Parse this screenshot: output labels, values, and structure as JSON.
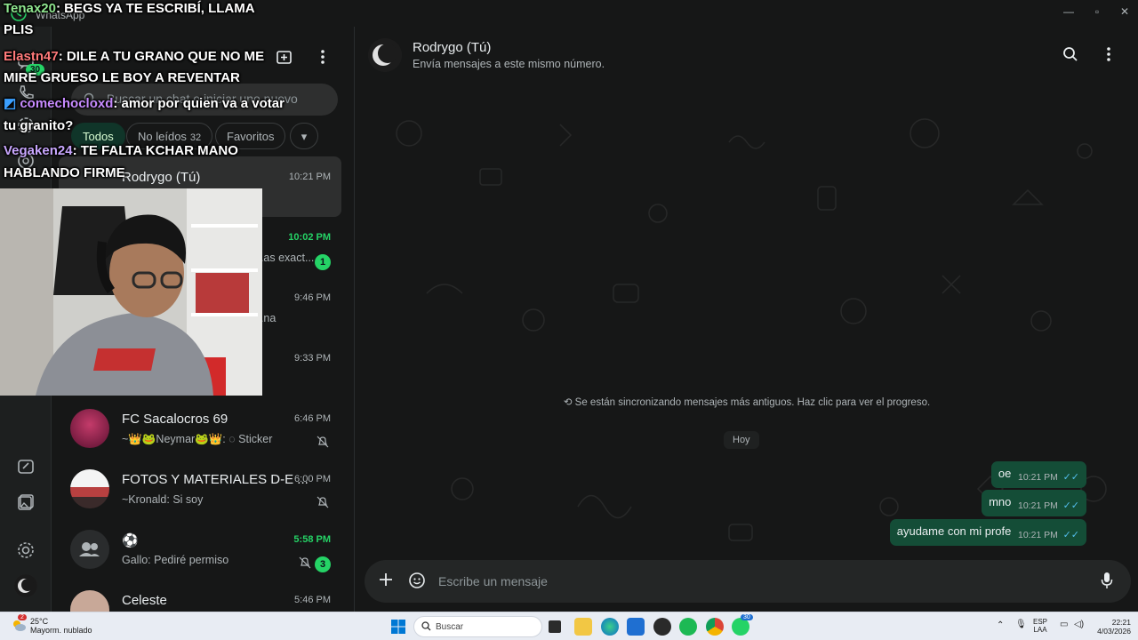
{
  "window": {
    "title": "WhatsApp"
  },
  "rail": {
    "chats_badge": "30"
  },
  "chatlist": {
    "search_placeholder": "Buscar un chat o iniciar uno nuevo",
    "filters": [
      {
        "label": "Todos",
        "count": ""
      },
      {
        "label": "No leídos",
        "count": "32"
      },
      {
        "label": "Favoritos",
        "count": ""
      }
    ],
    "chats": [
      {
        "name": "Rodrygo (Tú)",
        "preview": "",
        "time": "10:21 PM",
        "unread": ""
      },
      {
        "name": "",
        "preview": "...as exact...",
        "time": "10:02 PM",
        "unread": "1"
      },
      {
        "name": "",
        "preview": "...na",
        "time": "9:46 PM",
        "unread": ""
      },
      {
        "name": "",
        "preview": "",
        "time": "9:33 PM",
        "unread": ""
      },
      {
        "name": "FC Sacalocros 69",
        "preview": "~👑🐸Neymar🐸👑: ◌ Sticker",
        "time": "6:46 PM",
        "unread": ""
      },
      {
        "name": "FOTOS Y MATERIALES D-E ...",
        "preview": "~Kronald: Si soy",
        "time": "6:00 PM",
        "unread": ""
      },
      {
        "name": "⚽",
        "preview": "Gallo: Pediré permiso",
        "time": "5:58 PM",
        "unread": "3"
      },
      {
        "name": "Celeste",
        "preview": "",
        "time": "5:46 PM",
        "unread": ""
      }
    ]
  },
  "conversation": {
    "contact_name": "Rodrygo (Tú)",
    "contact_subtitle": "Envía mensajes a este mismo número.",
    "sync_notice": "Se están sincronizando mensajes más antiguos. Haz clic para ver el progreso.",
    "day_label": "Hoy",
    "messages": [
      {
        "text": "oe",
        "time": "10:21 PM"
      },
      {
        "text": "mno",
        "time": "10:21 PM"
      },
      {
        "text": "ayudame con mi profe",
        "time": "10:21 PM"
      }
    ],
    "composer_placeholder": "Escribe un mensaje"
  },
  "stream_chat": [
    {
      "user": "Tenax20",
      "text": ": BEGS YA TE ESCRIBÍ, LLAMA",
      "cont": "PLIS"
    },
    {
      "user": "Elastn47",
      "text": ": DILE A TU GRANO QUE NO ME",
      "cont": "MIRE GRUESO LE BOY A REVENTAR"
    },
    {
      "user": "comechocloxd",
      "text": ": amor por quien va a votar",
      "cont": "tu granito?"
    },
    {
      "user": "Vegaken24",
      "text": ": TE FALTA KCHAR MANO",
      "cont": "HABLANDO FIRME"
    }
  ],
  "taskbar": {
    "temp": "25°C",
    "weather": "Mayorm. nublado",
    "weather_badge": "2",
    "search_label": "Buscar",
    "lang_top": "ESP",
    "lang_bottom": "LAA",
    "time": "22:21",
    "date": "4/03/2026",
    "wa_badge": "30"
  },
  "colors": {
    "accent": "#25d366",
    "bubble_out": "#144d37",
    "bg": "#161717"
  }
}
